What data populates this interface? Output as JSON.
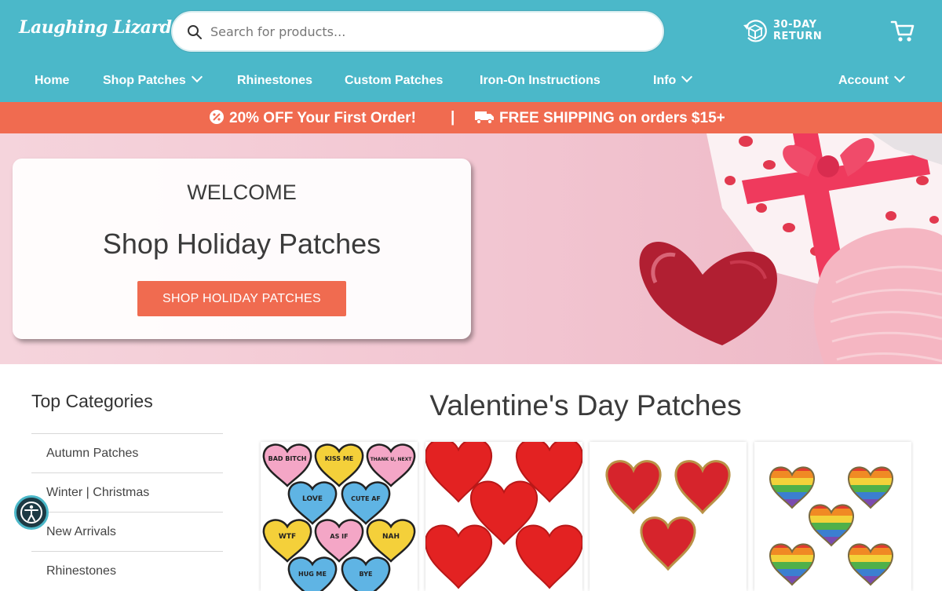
{
  "header": {
    "logo": "Laughing Lizards",
    "search_placeholder": "Search for products...",
    "returns_line1": "30-DAY",
    "returns_line2": "RETURN"
  },
  "nav": {
    "home": "Home",
    "shop_patches": "Shop Patches",
    "rhinestones": "Rhinestones",
    "custom_patches": "Custom Patches",
    "iron_on": "Iron-On Instructions",
    "info": "Info",
    "account": "Account"
  },
  "promo": {
    "offer": "20% OFF Your First Order!",
    "separator": "|",
    "shipping": "FREE SHIPPING on orders $15+"
  },
  "hero": {
    "welcome": "WELCOME",
    "title": "Shop Holiday Patches",
    "button": "SHOP HOLIDAY PATCHES"
  },
  "sidebar": {
    "title": "Top Categories",
    "items": [
      "Autumn Patches",
      "Winter | Christmas",
      "New Arrivals",
      "Rhinestones"
    ]
  },
  "main": {
    "section_title": "Valentine's Day Patches",
    "products": [
      {
        "image": "candy-heart-patches"
      },
      {
        "image": "red-heart-patches"
      },
      {
        "image": "red-gold-heart-patches"
      },
      {
        "image": "rainbow-heart-patches"
      }
    ],
    "candy_hearts": [
      "BAD BITCH",
      "KISS ME",
      "THANK U, NEXT",
      "LOVE",
      "CUTE AF",
      "WTF",
      "AS IF",
      "NAH",
      "HUG ME",
      "BYE"
    ]
  },
  "colors": {
    "header_teal": "#4bb8c9",
    "promo_coral": "#f06b50",
    "hero_pink": "#f2c5d1",
    "text_dark": "#3b3b3b"
  }
}
